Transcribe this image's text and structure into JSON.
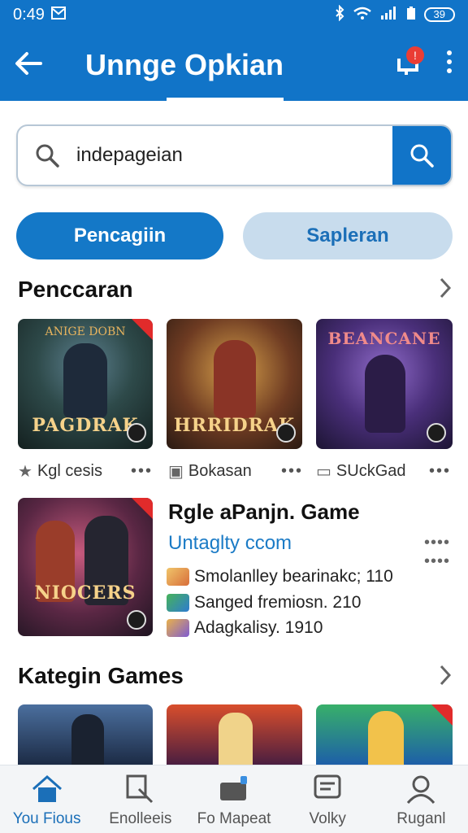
{
  "status": {
    "time": "0:49",
    "battery": "39"
  },
  "appbar": {
    "title": "Unnge Opkian",
    "notification_count": "!"
  },
  "search": {
    "value": "indepageian"
  },
  "chips": {
    "primary": "Pencagiin",
    "secondary": "Sapleran"
  },
  "section1": {
    "title": "Penccaran"
  },
  "games": [
    {
      "art_text": "PAGDRAK",
      "top_text": "ANIGE DOBN",
      "label": "Kgl cesis",
      "icon": "star-icon"
    },
    {
      "art_text": "HRRIDRAK",
      "label": "Bokasan",
      "icon": "book-icon"
    },
    {
      "art_text": "BEANCANE",
      "label": "SUckGad",
      "icon": "chat-icon"
    }
  ],
  "featured": {
    "art_text": "NIOCERS",
    "title": "Rgle aPanjn. Game",
    "subtitle": "Untaglty ccom",
    "stats": [
      {
        "text": "Smolanlley bearinakc; 110",
        "icon": "pencil-icon"
      },
      {
        "text": "Sanged fremiosn. 210",
        "icon": "puzzle-icon"
      },
      {
        "text": "Adagkalisy. 1910",
        "icon": "controller-icon"
      }
    ]
  },
  "section2": {
    "title": "Kategin Games"
  },
  "nav": [
    {
      "label": "You Fious",
      "icon": "home-icon",
      "active": true
    },
    {
      "label": "Enolleeis",
      "icon": "search-user-icon",
      "active": false
    },
    {
      "label": "Fo Mapeat",
      "icon": "wallet-icon",
      "active": false
    },
    {
      "label": "Volky",
      "icon": "message-icon",
      "active": false
    },
    {
      "label": "Ruganl",
      "icon": "profile-icon",
      "active": false
    }
  ],
  "colors": {
    "primary": "#1174c8",
    "chip_secondary": "#c8dced",
    "badge": "#ea3d35"
  }
}
